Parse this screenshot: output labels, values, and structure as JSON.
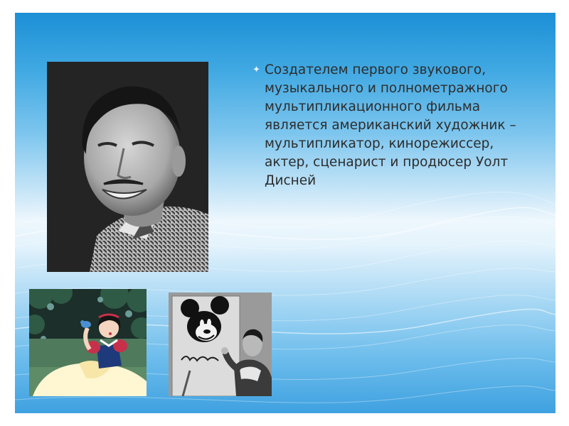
{
  "slide": {
    "body_text": "Создателем первого звукового, музыкального и полнометражного мультипликационного фильма является американский художник – мультипликатор, кинорежиссер, актер, сценарист и продюсер Уолт Дисней",
    "bullet_icon": "sparkle-bullet-icon"
  },
  "images": {
    "portrait": "portrait-photo",
    "snow_white": "snow-white-cartoon-image",
    "mickey_drawing": "artist-drawing-mickey-photo"
  },
  "colors": {
    "background_top": "#1c8fd6",
    "background_bottom": "#3fa1e0",
    "text": "#2d2d2d"
  }
}
